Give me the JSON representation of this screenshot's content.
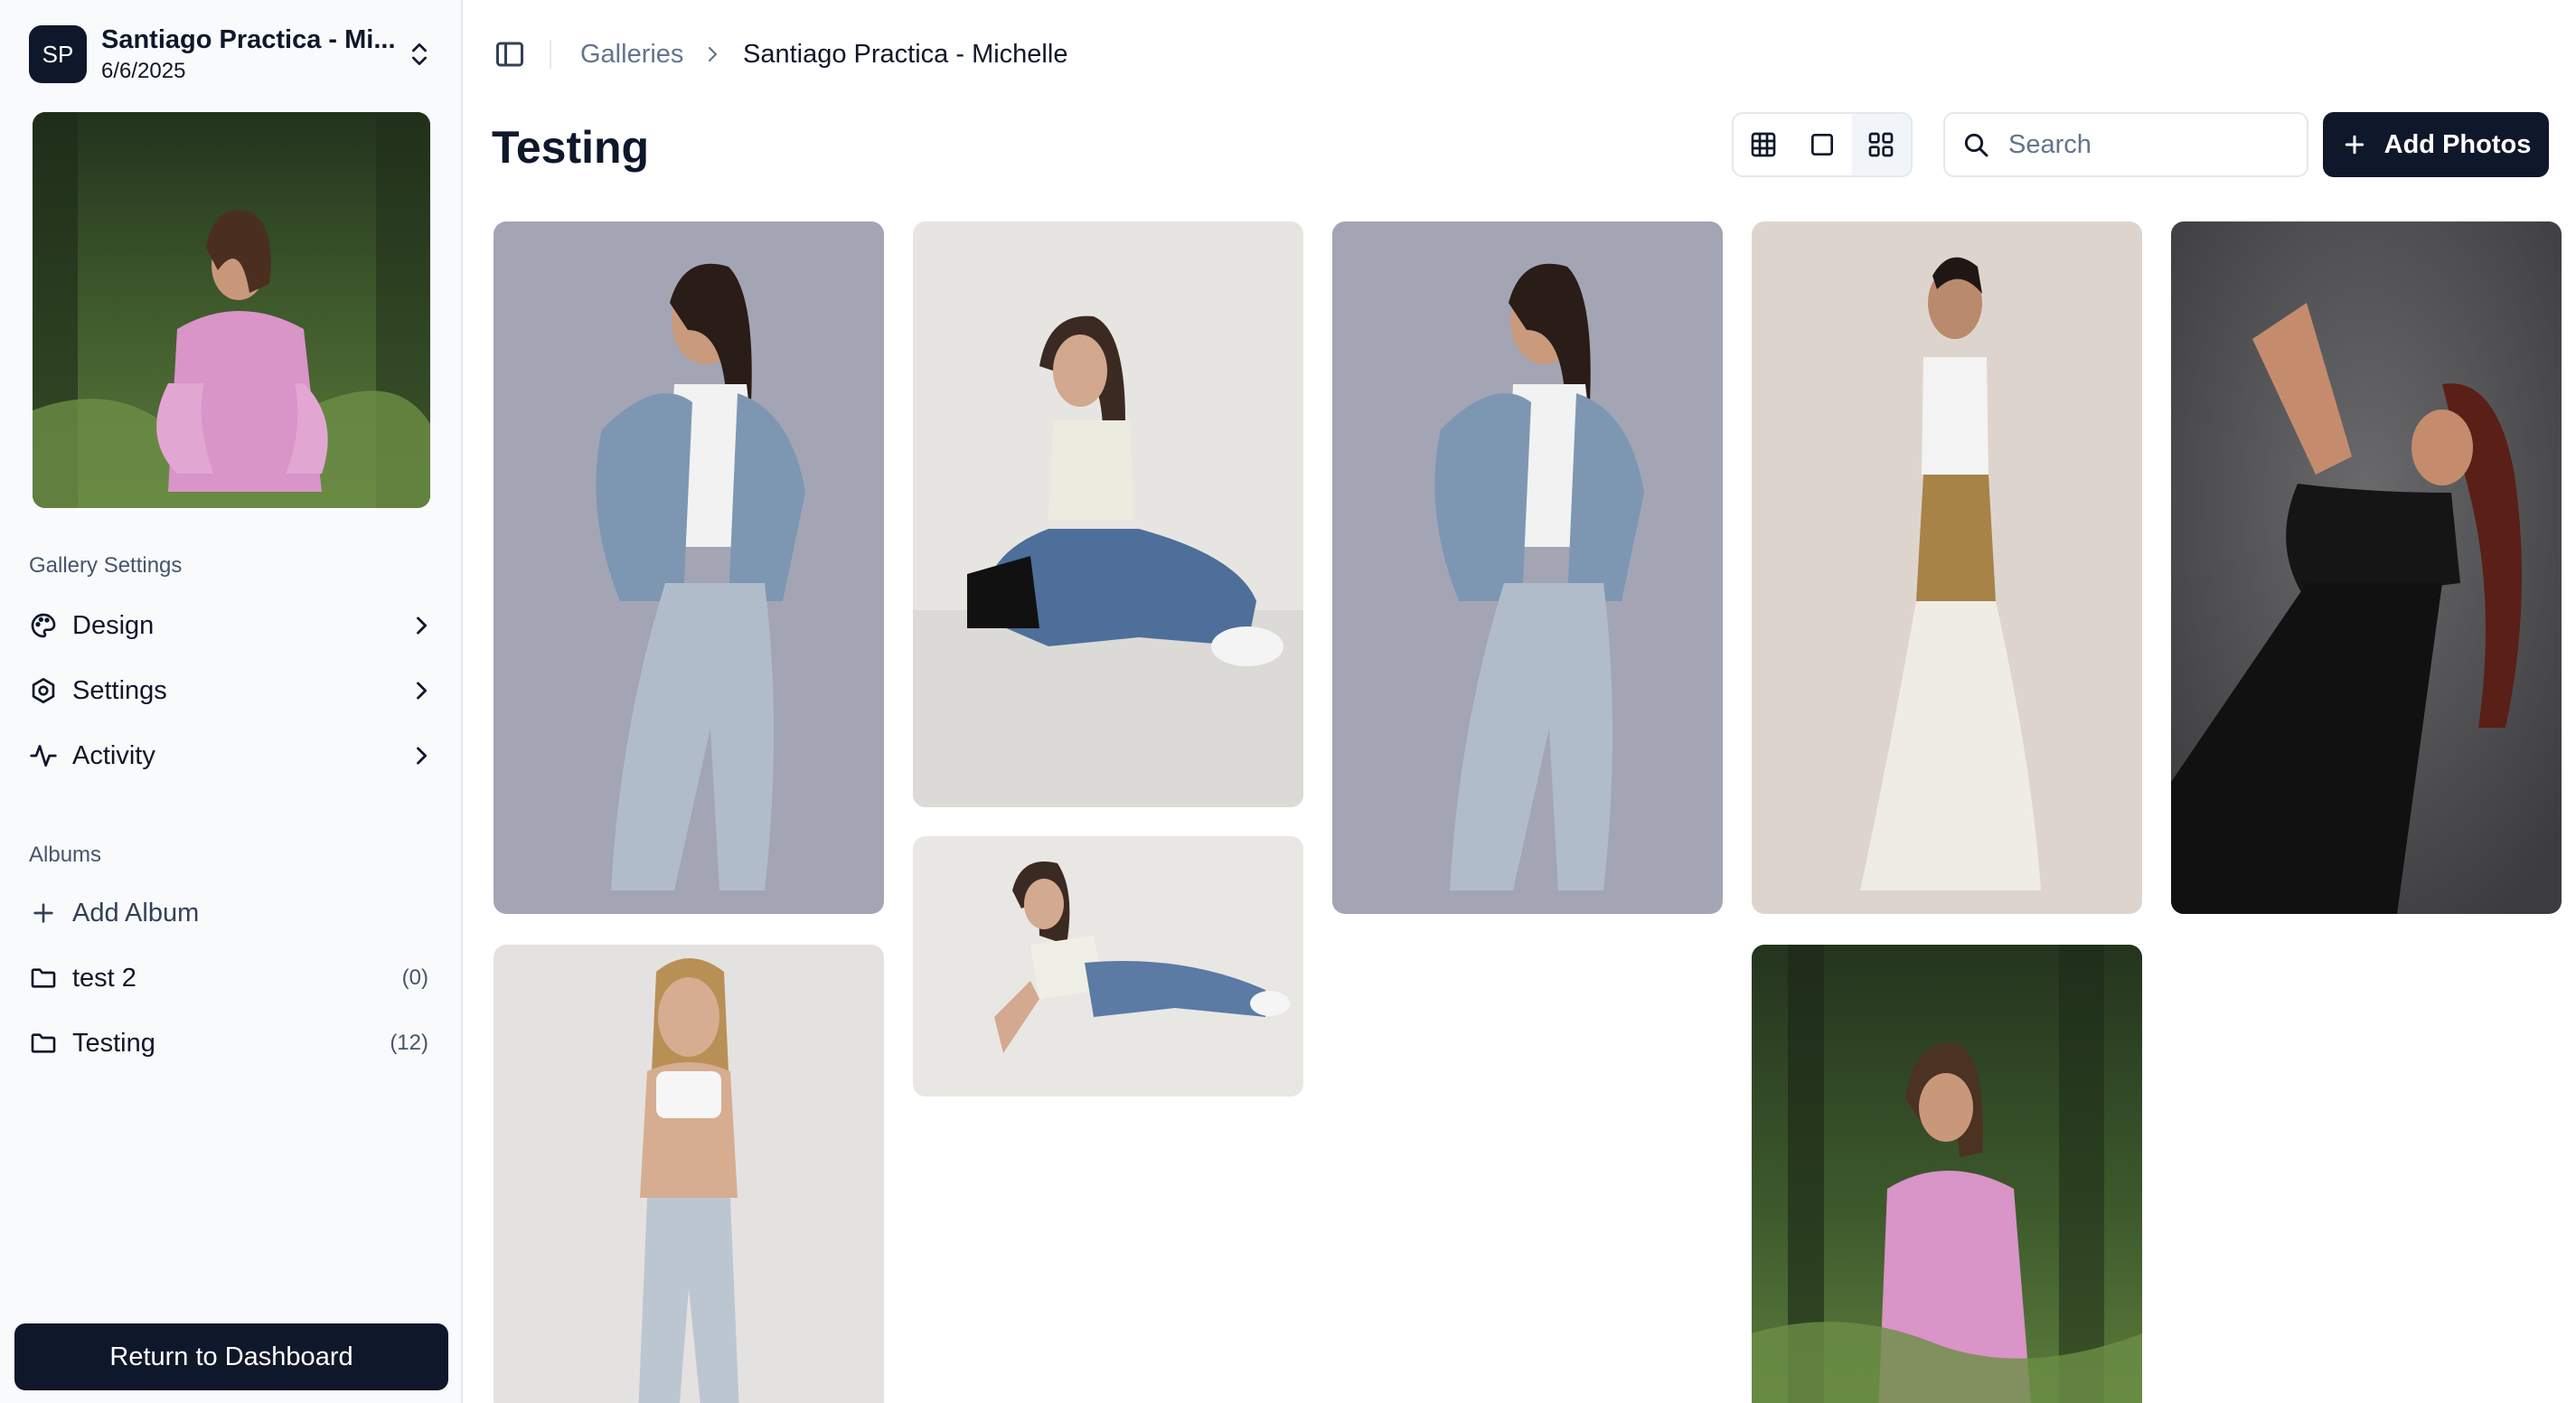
{
  "sidebar": {
    "avatar_initials": "SP",
    "gallery_title": "Santiago Practica - Mi...",
    "gallery_date": "6/6/2025",
    "settings_heading": "Gallery Settings",
    "settings_items": [
      {
        "label": "Design",
        "icon": "palette-icon"
      },
      {
        "label": "Settings",
        "icon": "gear-icon"
      },
      {
        "label": "Activity",
        "icon": "activity-icon"
      }
    ],
    "albums_heading": "Albums",
    "add_album_label": "Add Album",
    "albums": [
      {
        "label": "test 2",
        "count": "(0)"
      },
      {
        "label": "Testing",
        "count": "(12)"
      }
    ],
    "return_label": "Return to Dashboard"
  },
  "header": {
    "breadcrumb_root": "Galleries",
    "breadcrumb_current": "Santiago Practica - Michelle"
  },
  "main": {
    "title": "Testing",
    "view_modes": [
      "grid-small",
      "single",
      "grid-large"
    ],
    "active_view": "grid-large",
    "search_placeholder": "Search",
    "add_photos_label": "Add Photos"
  },
  "colors": {
    "primary": "#0f172a",
    "muted_text": "#64748b",
    "border": "#e5e7eb",
    "sidebar_bg": "#f8fafc"
  }
}
